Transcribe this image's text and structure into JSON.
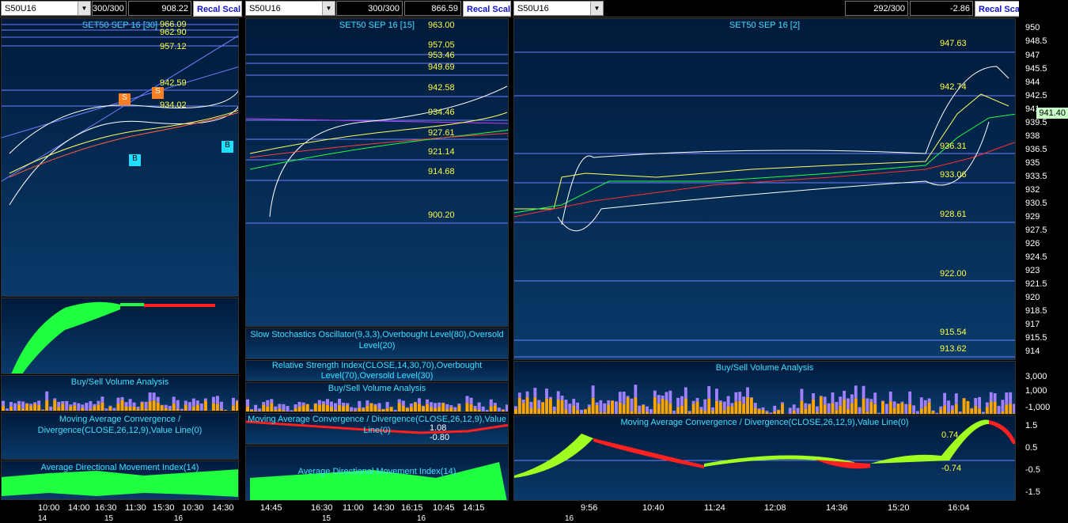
{
  "windows": [
    {
      "symbol": "S50U16",
      "bars": "300/300",
      "price": "908.22",
      "scale_button": "Recal Scal",
      "title": "SET50 SEP 16  [30]",
      "levels": [
        "966.09",
        "962.90",
        "957.12",
        "942.59",
        "934.02"
      ],
      "macd_title": "Moving Average Convergence / Divergence(CLOSE,26,12,9),Value Line(0)",
      "vol_title": "Buy/Sell Volume Analysis",
      "adx_title": "Average Directional Movement Index(14)",
      "markers": [
        "S",
        "S",
        "B",
        "B"
      ],
      "xticks": [
        "10:00",
        "14:00",
        "16:30",
        "11:30",
        "15:30",
        "10:30",
        "14:30"
      ],
      "dates": [
        "14",
        "15",
        "16"
      ]
    },
    {
      "symbol": "S50U16",
      "bars": "300/300",
      "price": "866.59",
      "scale_button": "Recal Scal",
      "title": "SET50 SEP 16  [15]",
      "levels": [
        "963.00",
        "957.05",
        "953.46",
        "949.69",
        "942.58",
        "934.46",
        "927.61",
        "921.14",
        "914.68",
        "900.20"
      ],
      "stoch_title": "Slow Stochastics Oscillator(9,3,3),Overbought Level(80),Oversold Level(20)",
      "rsi_title": "Relative Strength Index(CLOSE,14,30,70),Overbought Level(70),Oversold Level(30)",
      "vol_title": "Buy/Sell Volume Analysis",
      "macd_title": "Moving Average Convergence / Divergence(CLOSE,26,12,9),Value Line(0)",
      "macd_vals": [
        "1.08",
        "-0.80"
      ],
      "adx_title": "Average Directional Movement Index(14)",
      "xticks": [
        "14:45",
        "16:30",
        "11:00",
        "14:30",
        "16:15",
        "10:45",
        "14:15"
      ],
      "dates": [
        "15",
        "16"
      ]
    },
    {
      "symbol": "S50U16",
      "bars": "292/300",
      "price": "-2.86",
      "scale_button": "Recal Scale-Linear",
      "title": "SET50 SEP 16  [2]",
      "levels": [
        "947.63",
        "942.74",
        "936.31",
        "933.06",
        "928.61",
        "922.00",
        "915.54",
        "913.62"
      ],
      "last_price": "941.40",
      "yticks": [
        "950",
        "948.5",
        "947",
        "945.5",
        "944",
        "942.5",
        "941",
        "939.5",
        "938",
        "936.5",
        "935",
        "933.5",
        "932",
        "930.5",
        "929",
        "927.5",
        "926",
        "924.5",
        "923",
        "921.5",
        "920",
        "918.5",
        "917",
        "915.5",
        "914"
      ],
      "vol_title": "Buy/Sell Volume Analysis",
      "vol_ticks": [
        "3,000",
        "1,000",
        "-1,000"
      ],
      "macd_title": "Moving Average Convergence / Divergence(CLOSE,26,12,9),Value Line(0)",
      "macd_vals": [
        "0.74",
        "-0.74"
      ],
      "macd_ticks": [
        "1.5",
        "0.5",
        "-0.5",
        "-1.5"
      ],
      "xticks": [
        "9:56",
        "10:40",
        "11:24",
        "12:08",
        "14:36",
        "15:20",
        "16:04"
      ],
      "dates": [
        "16"
      ]
    }
  ],
  "colors": {
    "up": "#20ff40",
    "down": "#ff2020",
    "level": "#ffff40",
    "title": "#40e0ff",
    "vol_buy": "#ffa500",
    "vol_sell": "#a080ff"
  }
}
